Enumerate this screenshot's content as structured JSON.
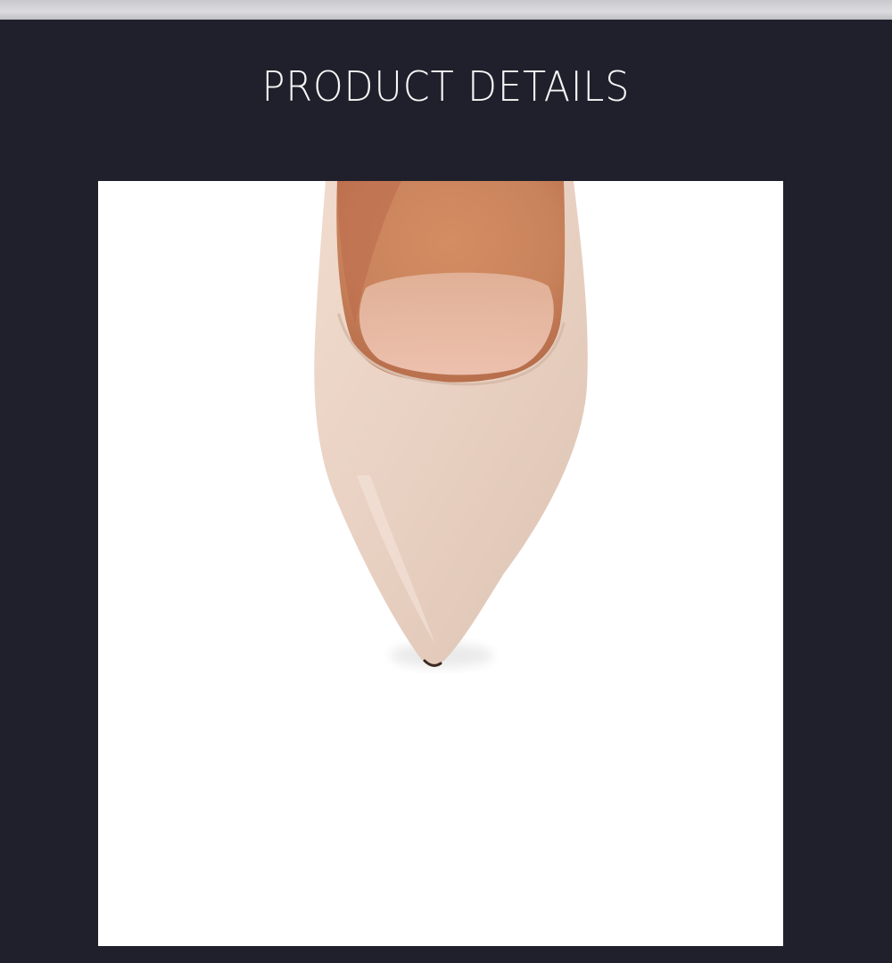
{
  "header": {
    "title": "PRODUCT DETAILS"
  },
  "product_image": {
    "subject": "pointed-toe-pump-shoe-image",
    "colors": {
      "background": "#20202c",
      "frame": "#ffffff",
      "suede": "#e9d3c5",
      "lining": "#c9825c"
    }
  }
}
